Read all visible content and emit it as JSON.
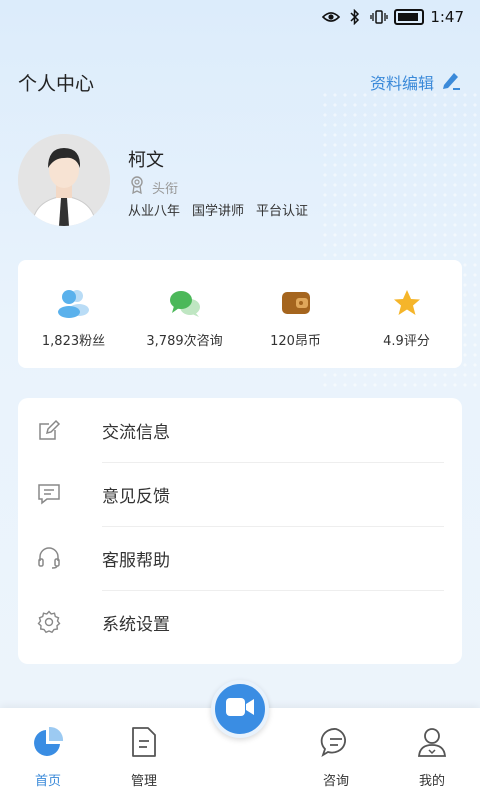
{
  "status_bar": {
    "time": "1:47"
  },
  "header": {
    "title": "个人中心",
    "edit_label": "资料编辑"
  },
  "profile": {
    "name": "柯文",
    "title_label": "头衔",
    "tags": [
      "从业八年",
      "国学讲师",
      "平台认证"
    ]
  },
  "stats": [
    {
      "label": "1,823粉丝",
      "icon": "fans-icon"
    },
    {
      "label": "3,789次咨询",
      "icon": "chat-icon"
    },
    {
      "label": "120昂币",
      "icon": "wallet-icon"
    },
    {
      "label": "4.9评分",
      "icon": "star-icon"
    }
  ],
  "menu": [
    {
      "label": "交流信息",
      "icon": "edit-icon"
    },
    {
      "label": "意见反馈",
      "icon": "feedback-icon"
    },
    {
      "label": "客服帮助",
      "icon": "headset-icon"
    },
    {
      "label": "系统设置",
      "icon": "gear-icon"
    }
  ],
  "nav": [
    {
      "label": "首页",
      "icon": "home-pie-icon",
      "active": true
    },
    {
      "label": "管理",
      "icon": "document-icon",
      "active": false
    },
    {
      "label": "",
      "icon": "video-camera-icon",
      "active": false
    },
    {
      "label": "咨询",
      "icon": "message-icon",
      "active": false
    },
    {
      "label": "我的",
      "icon": "user-icon",
      "active": false
    }
  ],
  "colors": {
    "accent": "#3b8ad9",
    "background": "#e6f1fb"
  }
}
